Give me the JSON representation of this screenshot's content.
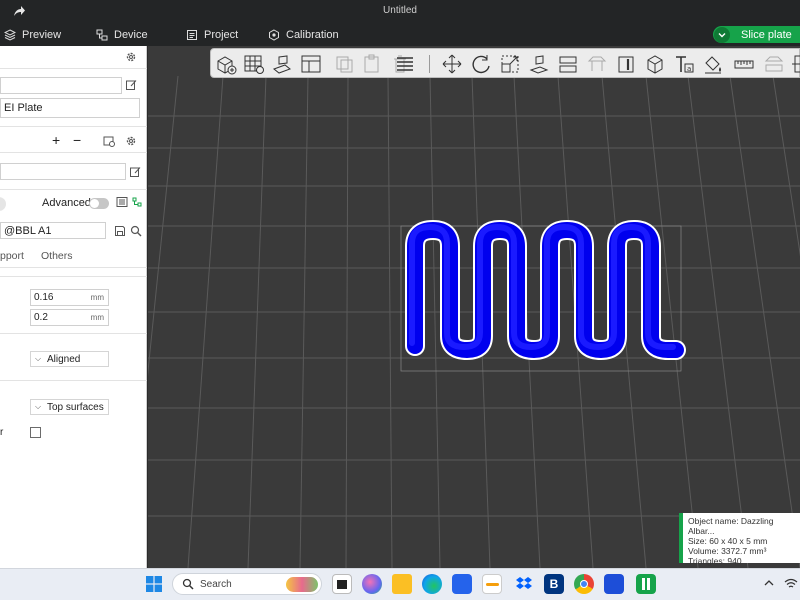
{
  "window": {
    "title": "Untitled"
  },
  "menu": {
    "tabs": [
      {
        "label": "Preview"
      },
      {
        "label": "Device"
      },
      {
        "label": "Project"
      },
      {
        "label": "Calibration"
      }
    ],
    "slice_label": "Slice plate"
  },
  "left_panel": {
    "plate_type": "EI Plate",
    "advanced_label": "Advanced",
    "process_preset": "@BBL A1",
    "tabs": {
      "support": "pport",
      "others": "Others"
    },
    "layer_height": {
      "value": "0.16",
      "unit": "mm"
    },
    "initial_layer_height": {
      "value": "0.2",
      "unit": "mm"
    },
    "seam_position": "Aligned",
    "ironing_type": "Top surfaces",
    "truncated_label": "r"
  },
  "toolbar": {
    "icons": [
      "add-object-icon",
      "arrange-grid-icon",
      "auto-orient-icon",
      "split-view-icon",
      "copy-icon",
      "paste-icon",
      "delete-icon",
      "layers-icon",
      "move-icon",
      "rotate-icon",
      "scale-icon",
      "lay-on-face-icon",
      "cut-icon",
      "support-paint-icon",
      "seam-paint-icon",
      "variable-layer-icon",
      "text-icon",
      "color-paint-icon",
      "measure-icon",
      "assembly-icon"
    ]
  },
  "object_info": {
    "name": "Object name: Dazzling Albar...",
    "size": "Size: 60 x 40 x 5 mm",
    "volume": "Volume: 3372.7 mm³",
    "triangles": "Triangles: 940"
  },
  "taskbar": {
    "search_placeholder": "Search"
  },
  "colors": {
    "accent_green": "#16a34a",
    "model_blue": "#0000ee",
    "viewport_bg": "#3a3a3a",
    "panel_bg": "#ffffff"
  }
}
